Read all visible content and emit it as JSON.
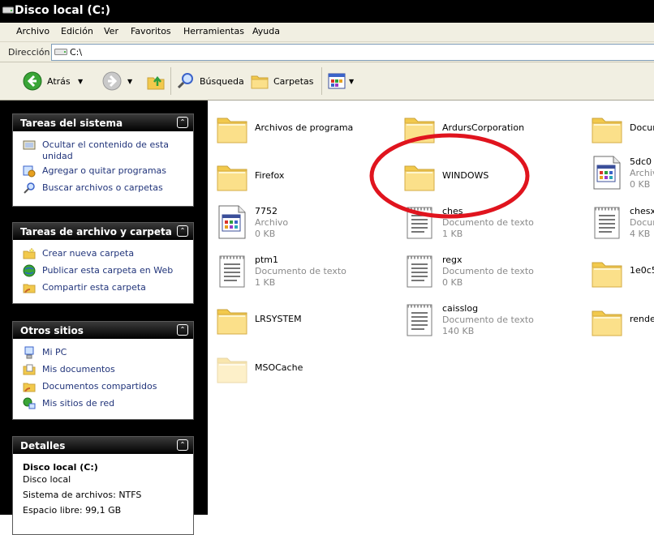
{
  "window": {
    "title": "Disco local (C:)"
  },
  "menu": [
    "Archivo",
    "Edición",
    "Ver",
    "Favoritos",
    "Herramientas",
    "Ayuda"
  ],
  "address": {
    "label": "Dirección",
    "value": "C:\\"
  },
  "toolbar": {
    "back": "Atrás",
    "search": "Búsqueda",
    "folders": "Carpetas"
  },
  "panels": {
    "system": {
      "title": "Tareas del sistema",
      "items": [
        {
          "label": "Ocultar el contenido de esta",
          "label2": "unidad",
          "icon": "hide-contents-icon"
        },
        {
          "label": "Agregar o quitar programas",
          "icon": "add-remove-programs-icon"
        },
        {
          "label": "Buscar archivos o carpetas",
          "icon": "search-icon"
        }
      ]
    },
    "file": {
      "title": "Tareas de archivo y carpeta",
      "items": [
        {
          "label": "Crear nueva carpeta",
          "icon": "new-folder-icon"
        },
        {
          "label": "Publicar esta carpeta en Web",
          "icon": "publish-web-icon"
        },
        {
          "label": "Compartir esta carpeta",
          "icon": "share-folder-icon"
        }
      ]
    },
    "places": {
      "title": "Otros sitios",
      "items": [
        {
          "label": "Mi PC",
          "icon": "my-computer-icon"
        },
        {
          "label": "Mis documentos",
          "icon": "my-documents-icon"
        },
        {
          "label": "Documentos compartidos",
          "icon": "shared-documents-icon"
        },
        {
          "label": "Mis sitios de red",
          "icon": "network-places-icon"
        }
      ]
    },
    "details": {
      "title": "Detalles",
      "name": "Disco local (C:)",
      "type": "Disco local",
      "fs": "Sistema de archivos: NTFS",
      "free": "Espacio libre: 99,1 GB"
    }
  },
  "files": [
    {
      "name": "Archivos de programa",
      "kind": "folder"
    },
    {
      "name": "ArdursCorporation",
      "kind": "folder"
    },
    {
      "name": "Docum",
      "kind": "folder"
    },
    {
      "name": "Firefox",
      "kind": "folder"
    },
    {
      "name": "WINDOWS",
      "kind": "folder"
    },
    {
      "name": "5dc0",
      "type": "Archiv",
      "size": "0 KB",
      "kind": "file"
    },
    {
      "name": "7752",
      "type": "Archivo",
      "size": "0 KB",
      "kind": "file"
    },
    {
      "name": "ches",
      "type": "Documento de texto",
      "size": "1 KB",
      "kind": "text"
    },
    {
      "name": "chesx",
      "type": "Docum",
      "size": "4 KB",
      "kind": "text"
    },
    {
      "name": "ptm1",
      "type": "Documento de texto",
      "size": "1 KB",
      "kind": "text"
    },
    {
      "name": "regx",
      "type": "Documento de texto",
      "size": "0 KB",
      "kind": "text"
    },
    {
      "name": "1e0c5",
      "kind": "folder"
    },
    {
      "name": "LRSYSTEM",
      "kind": "folder"
    },
    {
      "name": "caisslog",
      "type": "Documento de texto",
      "size": "140 KB",
      "kind": "text"
    },
    {
      "name": "rende",
      "kind": "folder"
    },
    {
      "name": "MSOCache",
      "kind": "folder-hidden"
    }
  ],
  "colors": {
    "title_bg": "#000000",
    "link_text": "#21347a",
    "annotation": "#e0141e",
    "folder": "#f7d35a"
  }
}
